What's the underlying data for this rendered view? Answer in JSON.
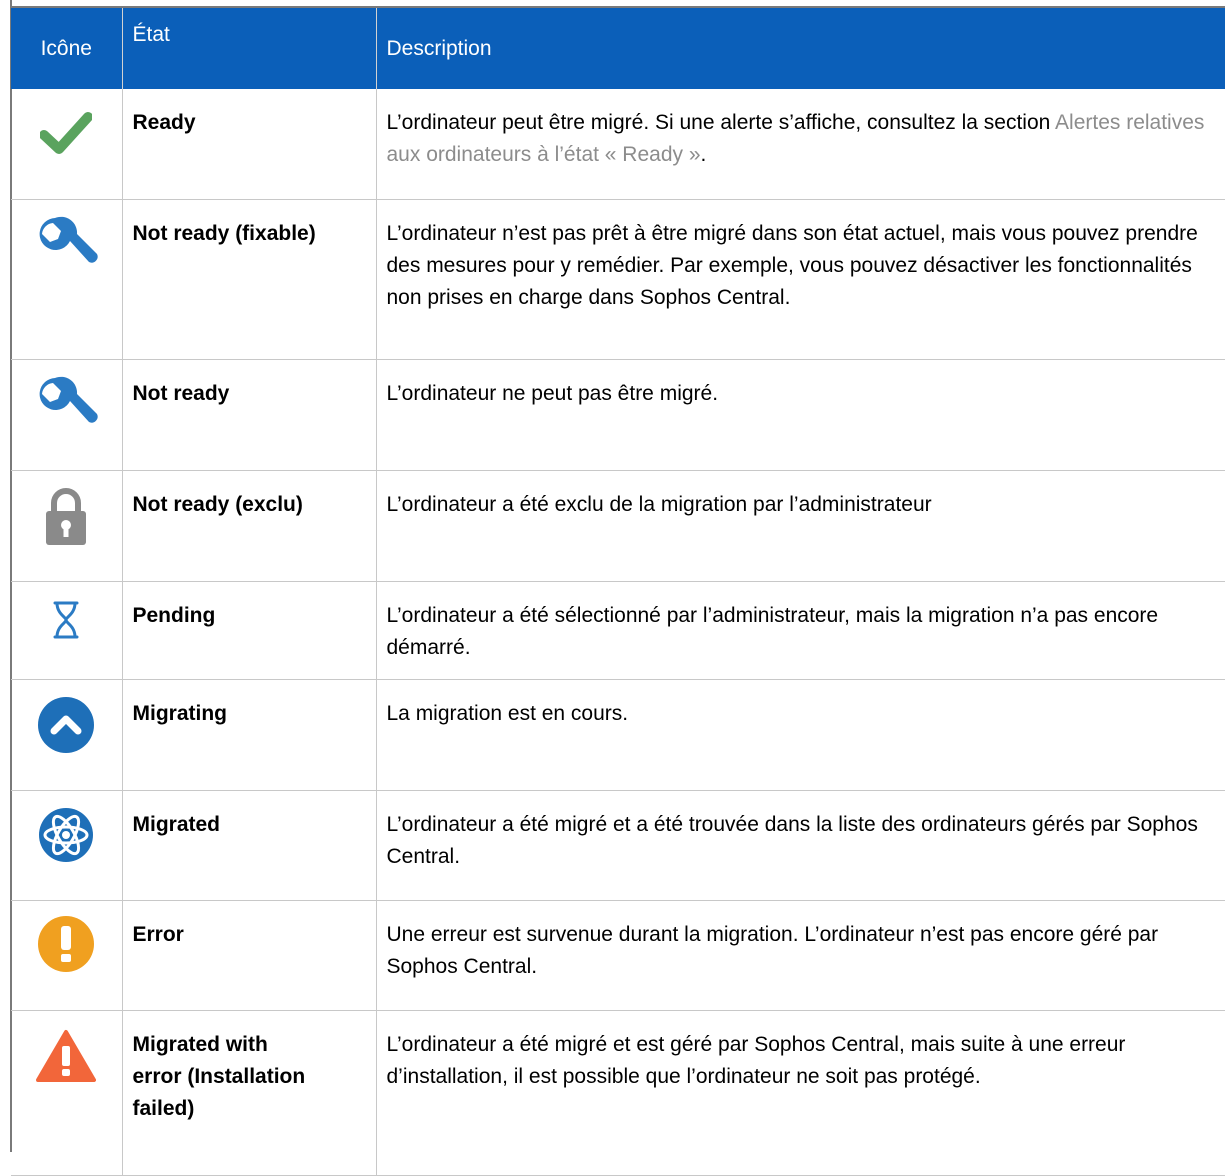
{
  "header": {
    "icon_label": "Icône",
    "state_label": "État",
    "description_label": "Description"
  },
  "rows": [
    {
      "icon": "check-icon",
      "state": "Ready",
      "description": "L’ordinateur peut être migré. Si une alerte s’affiche, consultez la section ",
      "link": "Alertes relatives aux ordinateurs à l’état « Ready »",
      "description_end": "."
    },
    {
      "icon": "wrench-icon",
      "state": "Not ready (fixable)",
      "description": "L’ordinateur n’est pas prêt à être migré dans son état actuel, mais vous pouvez prendre des mesures pour y remédier. Par exemple, vous pouvez désactiver les fonctionnalités non prises en charge dans Sophos Central."
    },
    {
      "icon": "wrench-icon",
      "state": "Not ready",
      "description": "L’ordinateur ne peut pas être migré."
    },
    {
      "icon": "lock-icon",
      "state": "Not ready (exclu)",
      "description": "L’ordinateur a été exclu de la migration par l’administrateur"
    },
    {
      "icon": "hourglass-icon",
      "state": "Pending",
      "description": "L’ordinateur a été sélectionné par l’administrateur, mais la migration n’a pas encore démarré."
    },
    {
      "icon": "chevron-up-circle-icon",
      "state": "Migrating",
      "description": "La migration est en cours."
    },
    {
      "icon": "atom-icon",
      "state": "Migrated",
      "description": "L’ordinateur a été migré et a été trouvée dans la liste des ordinateurs gérés par Sophos Central."
    },
    {
      "icon": "exclamation-circle-icon",
      "state": "Error",
      "description": "Une erreur est survenue durant la migration. L’ordinateur n’est pas encore géré par Sophos Central."
    },
    {
      "icon": "warning-triangle-icon",
      "state": "Migrated with error (Installation failed)",
      "description": "L’ordinateur a été migré et est géré par Sophos Central, mais suite à une erreur d’installation, il est possible que l’ordinateur ne soit pas protégé."
    }
  ],
  "colors": {
    "header_bg": "#0b5fb9",
    "check": "#5aa35e",
    "wrench": "#2b7bc4",
    "lock": "#8a8a8a",
    "hourglass": "#2b7bc4",
    "migrating": "#1e6fb8",
    "migrated": "#1e6fb8",
    "error": "#f0a020",
    "warning": "#f2663a",
    "link": "#8c8c8c"
  }
}
